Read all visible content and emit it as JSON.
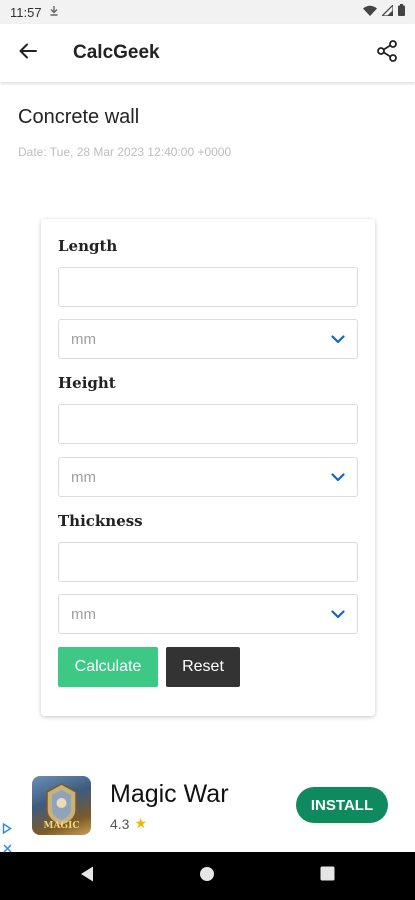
{
  "status_bar": {
    "time": "11:57",
    "download_icon": "download-icon",
    "wifi_icon": "wifi-icon",
    "signal_icon": "signal-icon",
    "battery_icon": "battery-icon"
  },
  "app_bar": {
    "title": "CalcGeek",
    "back_icon": "arrow-left-icon",
    "share_icon": "share-icon"
  },
  "page": {
    "title": "Concrete wall",
    "date": "Date: Tue, 28 Mar 2023 12:40:00 +0000"
  },
  "form": {
    "length": {
      "label": "Length",
      "value": "",
      "unit": "mm"
    },
    "height": {
      "label": "Height",
      "value": "",
      "unit": "mm"
    },
    "thickness": {
      "label": "Thickness",
      "value": "",
      "unit": "mm"
    },
    "calculate_label": "Calculate",
    "reset_label": "Reset"
  },
  "ad": {
    "title": "Magic War",
    "rating": "4.3",
    "install_label": "INSTALL",
    "icon_text": "MAGIC"
  },
  "colors": {
    "accent": "#3dc985",
    "reset": "#333333",
    "install": "#0f8a5f",
    "chevron": "#1565c0"
  }
}
